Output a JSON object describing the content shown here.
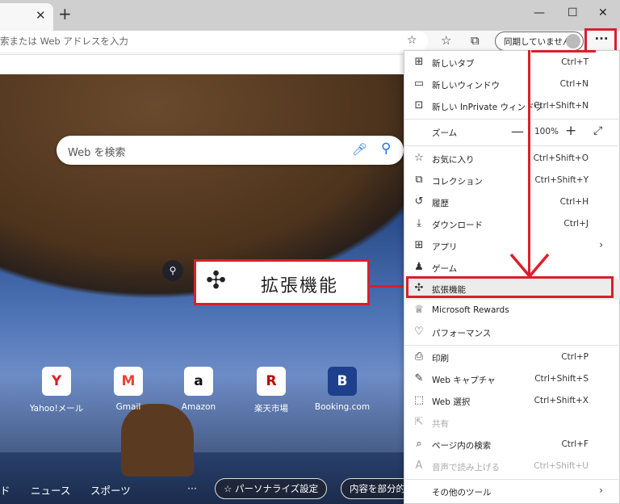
{
  "window": {
    "tab_close": "✕",
    "new_tab": "+",
    "minimize": "—",
    "maximize": "☐",
    "close": "✕"
  },
  "address_bar": {
    "text": "索または Web アドレスを入力"
  },
  "toolbar": {
    "sync_label": "同期していません",
    "more_label": "···"
  },
  "search": {
    "placeholder": "Web を検索"
  },
  "callout": {
    "label": "拡張機能"
  },
  "tiles": [
    {
      "label": "Yahoo!メール",
      "glyph": "Y",
      "color": "#d8202c"
    },
    {
      "label": "Gmail",
      "glyph": "M",
      "color": "#ea4335"
    },
    {
      "label": "Amazon",
      "glyph": "a",
      "color": "#111111"
    },
    {
      "label": "楽天市場",
      "glyph": "R",
      "color": "#bf0000"
    },
    {
      "label": "Booking.com",
      "glyph": "B",
      "color": "#ffffff"
    }
  ],
  "bottom_nav": {
    "item0": "ド",
    "item1": "ニュース",
    "item2": "スポーツ",
    "more": "···",
    "personalize": "パーソナライズ設定",
    "partial": "内容を部分的"
  },
  "menu": {
    "new_tab": {
      "label": "新しいタブ",
      "shortcut": "Ctrl+T"
    },
    "new_window": {
      "label": "新しいウィンドウ",
      "shortcut": "Ctrl+N"
    },
    "new_inprivate": {
      "label": "新しい InPrivate ウィンドウ",
      "shortcut": "Ctrl+Shift+N"
    },
    "zoom": {
      "label": "ズーム",
      "value": "100%",
      "minus": "—",
      "plus": "+",
      "full": "⤢"
    },
    "favorites": {
      "label": "お気に入り",
      "shortcut": "Ctrl+Shift+O"
    },
    "collections": {
      "label": "コレクション",
      "shortcut": "Ctrl+Shift+Y"
    },
    "history": {
      "label": "履歴",
      "shortcut": "Ctrl+H"
    },
    "downloads": {
      "label": "ダウンロード",
      "shortcut": "Ctrl+J"
    },
    "apps": {
      "label": "アプリ",
      "arrow": "›"
    },
    "games": {
      "label": "ゲーム"
    },
    "extensions": {
      "label": "拡張機能"
    },
    "rewards": {
      "label": "Microsoft Rewards"
    },
    "performance": {
      "label": "パフォーマンス"
    },
    "print": {
      "label": "印刷",
      "shortcut": "Ctrl+P"
    },
    "web_capture": {
      "label": "Web キャプチャ",
      "shortcut": "Ctrl+Shift+S"
    },
    "web_select": {
      "label": "Web 選択",
      "shortcut": "Ctrl+Shift+X"
    },
    "share": {
      "label": "共有"
    },
    "find": {
      "label": "ページ内の検索",
      "shortcut": "Ctrl+F"
    },
    "read_aloud": {
      "label": "音声で読み上げる",
      "shortcut": "Ctrl+Shift+U"
    },
    "more_tools": {
      "label": "その他のツール",
      "arrow": "›"
    }
  },
  "colors": {
    "highlight_red": "#d8202c"
  }
}
